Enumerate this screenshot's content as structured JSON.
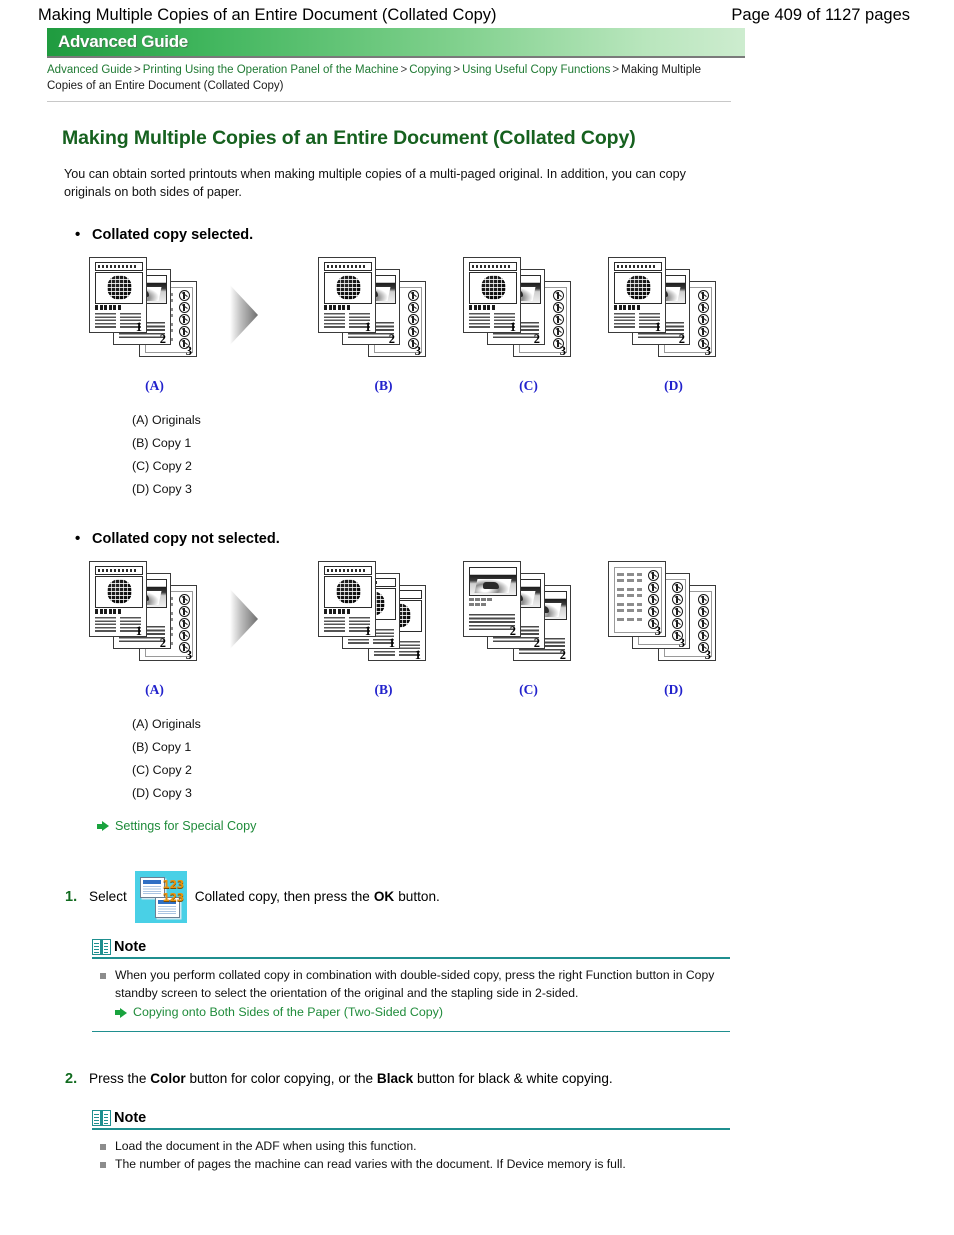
{
  "header": {
    "doc_title": "Making Multiple Copies of an Entire Document (Collated Copy)",
    "page_count": "Page 409 of 1127 pages"
  },
  "banner": {
    "label": "Advanced Guide"
  },
  "breadcrumb": {
    "items": [
      "Advanced Guide",
      "Printing Using the Operation Panel of the Machine",
      "Copying",
      "Using Useful Copy Functions"
    ],
    "separator": ">",
    "current": "Making Multiple Copies of an Entire Document (Collated Copy)"
  },
  "main": {
    "title": "Making Multiple Copies of an Entire Document (Collated Copy)",
    "intro": "You can obtain sorted printouts when making multiple copies of a multi-paged original. In addition, you can copy originals on both sides of paper."
  },
  "sections": [
    {
      "heading": "Collated copy selected.",
      "groups": [
        {
          "label": "(A)",
          "pages": [
            "1",
            "2",
            "3"
          ]
        },
        {
          "label": "(B)",
          "pages": [
            "1",
            "2",
            "3"
          ]
        },
        {
          "label": "(C)",
          "pages": [
            "1",
            "2",
            "3"
          ]
        },
        {
          "label": "(D)",
          "pages": [
            "1",
            "2",
            "3"
          ]
        }
      ],
      "legend": [
        "(A) Originals",
        "(B) Copy 1",
        "(C) Copy 2",
        "(D) Copy 3"
      ]
    },
    {
      "heading": "Collated copy not selected.",
      "groups": [
        {
          "label": "(A)",
          "pages": [
            "1",
            "2",
            "3"
          ]
        },
        {
          "label": "(B)",
          "pages": [
            "1",
            "1",
            "1"
          ]
        },
        {
          "label": "(C)",
          "pages": [
            "2",
            "2",
            "2"
          ]
        },
        {
          "label": "(D)",
          "pages": [
            "3",
            "3",
            "3"
          ]
        }
      ],
      "legend": [
        "(A) Originals",
        "(B) Copy 1",
        "(C) Copy 2",
        "(D) Copy 3"
      ]
    }
  ],
  "special_copy_link": "Settings for Special Copy",
  "steps": [
    {
      "num": "1.",
      "text_before": "Select",
      "icon_name": "collated-copy-icon",
      "text_mid": "Collated copy, then press the",
      "bold_word": "OK",
      "text_after": "button."
    },
    {
      "num": "2.",
      "text_before": "Press the",
      "bold_word_1": "Color",
      "text_mid": "button for color copying, or the",
      "bold_word_2": "Black",
      "text_after": "button for black & white copying."
    }
  ],
  "notes": [
    {
      "title": "Note",
      "items": [
        "When you perform collated copy in combination with double-sided copy, press the right Function button in Copy standby screen to select the orientation of the original and the stapling side in 2-sided."
      ],
      "sub_link": "Copying onto Both Sides of the Paper (Two-Sided Copy)"
    },
    {
      "title": "Note",
      "items": [
        "Load the document in the ADF when using this function.",
        "The number of pages the machine can read varies with the document. If Device memory is full."
      ],
      "sub_link": null
    }
  ],
  "colors": {
    "title_green": "#16611f",
    "link_green": "#1f8b3a",
    "note_teal": "#1f8f8f",
    "label_blue": "#2222cc",
    "icon_cyan": "#49d0e6"
  }
}
